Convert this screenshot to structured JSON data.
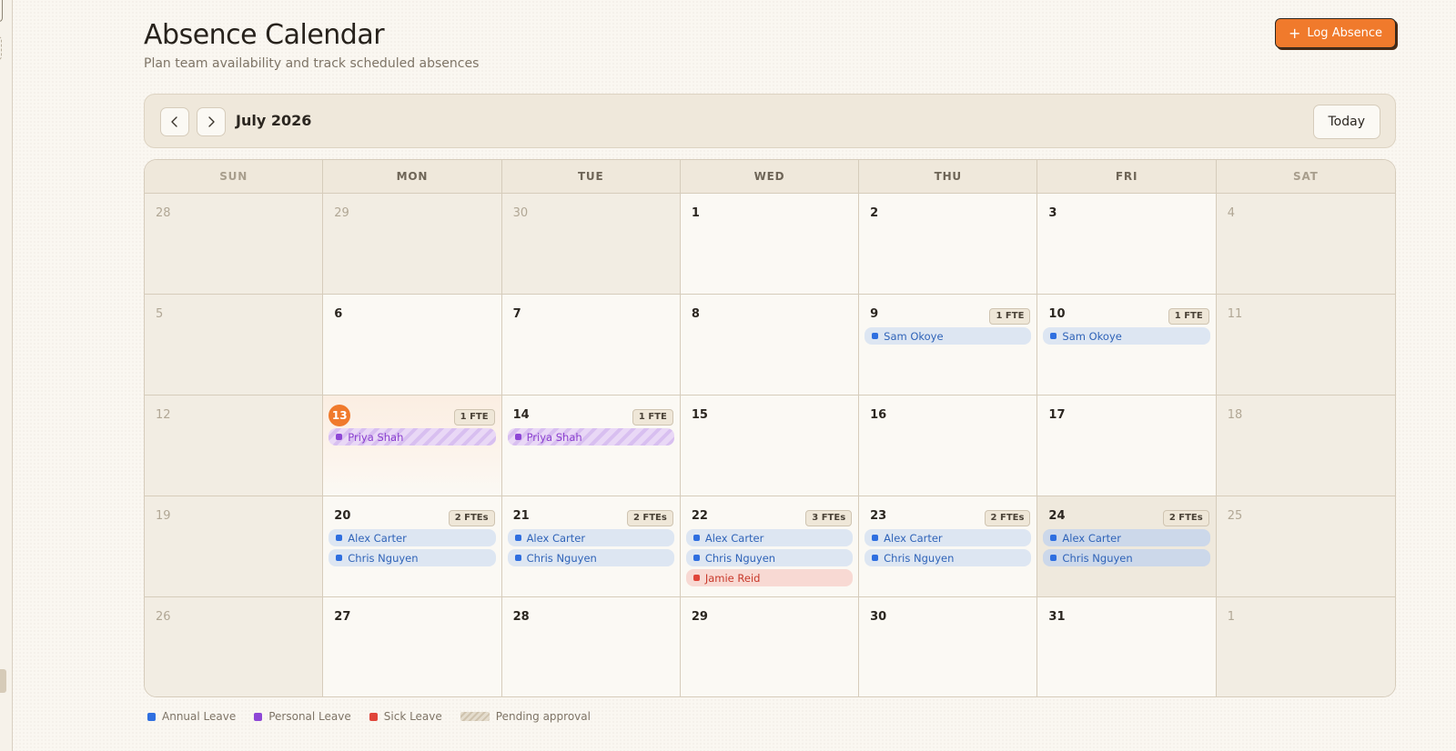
{
  "page": {
    "title": "Absence Calendar",
    "subtitle": "Plan team availability and track scheduled absences",
    "log_button": "Log Absence"
  },
  "toolbar": {
    "month": "July 2026",
    "today_button": "Today",
    "prev_icon": "chevron-left-icon",
    "next_icon": "chevron-right-icon"
  },
  "weekdays": [
    "SUN",
    "MON",
    "TUE",
    "WED",
    "THU",
    "FRI",
    "SAT"
  ],
  "weeks": [
    [
      {
        "day": "28",
        "outside": true
      },
      {
        "day": "29",
        "outside": true
      },
      {
        "day": "30",
        "outside": true
      },
      {
        "day": "1"
      },
      {
        "day": "2"
      },
      {
        "day": "3"
      },
      {
        "day": "4",
        "weekend": true
      }
    ],
    [
      {
        "day": "5",
        "weekend": true
      },
      {
        "day": "6"
      },
      {
        "day": "7"
      },
      {
        "day": "8"
      },
      {
        "day": "9",
        "fte": "1 FTE",
        "events": [
          {
            "name": "Sam Okoye",
            "type": "annual"
          }
        ]
      },
      {
        "day": "10",
        "fte": "1 FTE",
        "events": [
          {
            "name": "Sam Okoye",
            "type": "annual"
          }
        ]
      },
      {
        "day": "11",
        "weekend": true
      }
    ],
    [
      {
        "day": "12",
        "weekend": true
      },
      {
        "day": "13",
        "today": true,
        "fte": "1 FTE",
        "events": [
          {
            "name": "Priya Shah",
            "type": "personal",
            "pending": true
          }
        ]
      },
      {
        "day": "14",
        "fte": "1 FTE",
        "events": [
          {
            "name": "Priya Shah",
            "type": "personal",
            "pending": true
          }
        ]
      },
      {
        "day": "15"
      },
      {
        "day": "16"
      },
      {
        "day": "17"
      },
      {
        "day": "18",
        "weekend": true
      }
    ],
    [
      {
        "day": "19",
        "weekend": true
      },
      {
        "day": "20",
        "fte": "2 FTEs",
        "events": [
          {
            "name": "Alex Carter",
            "type": "annual"
          },
          {
            "name": "Chris Nguyen",
            "type": "annual"
          }
        ]
      },
      {
        "day": "21",
        "fte": "2 FTEs",
        "events": [
          {
            "name": "Alex Carter",
            "type": "annual"
          },
          {
            "name": "Chris Nguyen",
            "type": "annual"
          }
        ]
      },
      {
        "day": "22",
        "fte": "3 FTEs",
        "events": [
          {
            "name": "Alex Carter",
            "type": "annual"
          },
          {
            "name": "Chris Nguyen",
            "type": "annual"
          },
          {
            "name": "Jamie Reid",
            "type": "sick"
          }
        ]
      },
      {
        "day": "23",
        "fte": "2 FTEs",
        "events": [
          {
            "name": "Alex Carter",
            "type": "annual"
          },
          {
            "name": "Chris Nguyen",
            "type": "annual"
          }
        ]
      },
      {
        "day": "24",
        "highlight": true,
        "fte": "2 FTEs",
        "events": [
          {
            "name": "Alex Carter",
            "type": "annual"
          },
          {
            "name": "Chris Nguyen",
            "type": "annual"
          }
        ]
      },
      {
        "day": "25",
        "weekend": true
      }
    ],
    [
      {
        "day": "26",
        "weekend": true
      },
      {
        "day": "27"
      },
      {
        "day": "28"
      },
      {
        "day": "29"
      },
      {
        "day": "30"
      },
      {
        "day": "31"
      },
      {
        "day": "1",
        "outside": true
      }
    ]
  ],
  "legend": [
    {
      "label": "Annual Leave",
      "type": "annual"
    },
    {
      "label": "Personal Leave",
      "type": "personal"
    },
    {
      "label": "Sick Leave",
      "type": "sick"
    },
    {
      "label": "Pending approval",
      "type": "pending"
    }
  ],
  "colors": {
    "accent": "#f07a2c",
    "annual": "#2f6fe0",
    "personal": "#8e47d6",
    "sick": "#e0453a"
  }
}
